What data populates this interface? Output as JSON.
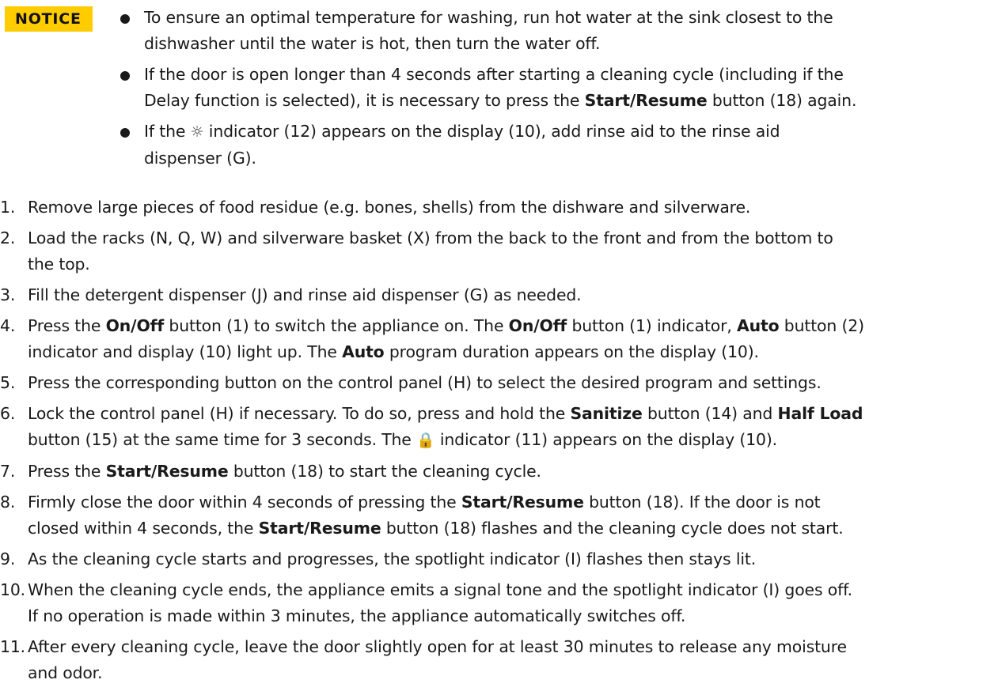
{
  "notice": {
    "label": "NOTICE",
    "items": [
      "To ensure an optimal temperature for washing, run hot water at the sink closest to the dishwasher until the water is hot, then turn the water off.",
      "If the door is open longer than 4 seconds after starting a cleaning cycle (including if the Delay function is selected), it is necessary to press the Start/Resume button (18) again.",
      "If the ☼ indicator (12) appears on the display (10), add rinse aid to the rinse aid dispenser (G)."
    ]
  },
  "steps": [
    {
      "num": "1.",
      "text": "Remove large pieces of food residue (e.g. bones, shells) from the dishware and silverware."
    },
    {
      "num": "2.",
      "text": "Load the racks (N, Q, W) and silverware basket (X) from the back to the front and from the bottom to the top."
    },
    {
      "num": "3.",
      "text": "Fill the detergent dispenser (J) and rinse aid dispenser (G) as needed."
    },
    {
      "num": "4.",
      "text": "Press the On/Off button (1) to switch the appliance on. The On/Off button (1) indicator, Auto button (2) indicator and display (10) light up. The Auto program duration appears on the display (10)."
    },
    {
      "num": "5.",
      "text": "Press the corresponding button on the control panel (H) to select the desired program and settings."
    },
    {
      "num": "6.",
      "text": "Lock the control panel (H) if necessary. To do so, press and hold the Sanitize button (14) and Half Load button (15) at the same time for 3 seconds. The 🔒 indicator (11) appears on the display (10)."
    },
    {
      "num": "7.",
      "text": "Press the Start/Resume button (18) to start the cleaning cycle."
    },
    {
      "num": "8.",
      "text": "Firmly close the door within 4 seconds of pressing the Start/Resume button (18). If the door is not closed within 4 seconds, the Start/Resume button (18) flashes and the cleaning cycle does not start."
    },
    {
      "num": "9.",
      "text": "As the cleaning cycle starts and progresses, the spotlight indicator (I) flashes then stays lit."
    },
    {
      "num": "10.",
      "text": "When the cleaning cycle ends, the appliance emits a signal tone and the spotlight indicator (I) goes off. If no operation is made within 3 minutes, the appliance automatically switches off."
    },
    {
      "num": "11.",
      "text": "After every cleaning cycle, leave the door slightly open for at least 30 minutes to release any moisture and odor."
    }
  ]
}
